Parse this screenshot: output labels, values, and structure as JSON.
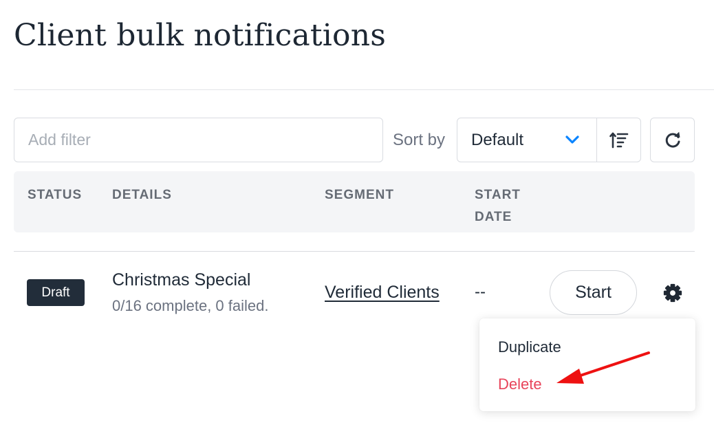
{
  "page": {
    "title": "Client bulk notifications"
  },
  "toolbar": {
    "filter_placeholder": "Add filter",
    "sort_label": "Sort by",
    "sort_value": "Default",
    "accent_color": "#0a84ff"
  },
  "table": {
    "headers": {
      "status": "STATUS",
      "details": "DETAILS",
      "segment": "SEGMENT",
      "start_date": "START DATE"
    },
    "rows": [
      {
        "status": "Draft",
        "name": "Christmas Special",
        "progress": "0/16 complete, 0 failed.",
        "segment": "Verified Clients",
        "start_date": "--",
        "action_label": "Start"
      }
    ]
  },
  "menu": {
    "items": [
      "Duplicate",
      "Delete"
    ],
    "delete_color": "#e8445a"
  },
  "annotation": {
    "color": "#ee1111"
  },
  "icons": {
    "sort_chevron": "chevron-down-icon",
    "sort_direction": "sort-ascending-icon",
    "refresh": "refresh-icon",
    "settings": "gear-icon"
  }
}
